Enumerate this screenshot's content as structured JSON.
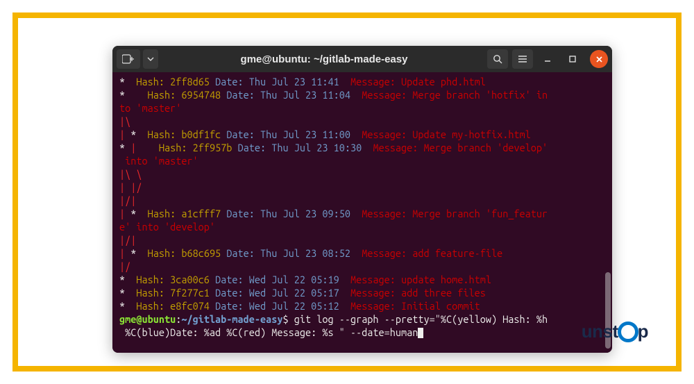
{
  "titlebar": {
    "title": "gme@ubuntu: ~/gitlab-made-easy"
  },
  "log": [
    {
      "graph": "* ",
      "hash": "2ff8d65",
      "date": "Thu Jul 23 11:41",
      "msg": "Update phd.html"
    },
    {
      "graph": "*   ",
      "hash": "6954748",
      "date": "Thu Jul 23 11:04",
      "msg": "Merge branch 'hotfix' in",
      "wrap": "to 'master'"
    },
    {
      "graphonly": "|\\  "
    },
    {
      "graph": "| * ",
      "hash": "b0df1fc",
      "date": "Thu Jul 23 11:00",
      "msg": "Update my-hotfix.html"
    },
    {
      "graph": "* |   ",
      "hash": "2ff957b",
      "date": "Thu Jul 23 10:30",
      "msg": "Merge branch 'develop'",
      "wrap": " into 'master'"
    },
    {
      "graphonly": "|\\ \\  "
    },
    {
      "graphonly": "| |/  "
    },
    {
      "graphonly": "|/|   "
    },
    {
      "graph": "| * ",
      "hash": "a1cfff7",
      "date": "Thu Jul 23 09:50",
      "msg": "Merge branch 'fun_featur",
      "wrap": "e' into 'develop'"
    },
    {
      "graphonly": "|/|   "
    },
    {
      "graph": "| * ",
      "hash": "b68c695",
      "date": "Thu Jul 23 08:52",
      "msg": "add feature-file"
    },
    {
      "graphonly": "|/  "
    },
    {
      "graph": "* ",
      "hash": "3ca00c6",
      "date": "Wed Jul 22 05:19",
      "msg": "update home.html"
    },
    {
      "graph": "* ",
      "hash": "7f277c1",
      "date": "Wed Jul 22 05:17",
      "msg": "add three files"
    },
    {
      "graph": "* ",
      "hash": "e8fc074",
      "date": "Wed Jul 22 05:12",
      "msg": "Initial commit"
    }
  ],
  "labels": {
    "hash": "Hash: ",
    "date": "Date: ",
    "message": " Message: "
  },
  "prompt": {
    "userhost": "gme@ubuntu",
    "sep": ":",
    "path": "~/gitlab-made-easy",
    "dollar": "$ ",
    "cmd1": "git log --graph --pretty=\"%C(yellow) Hash: %h",
    "cmd2": " %C(blue)Date: %ad %C(red) Message: %s \" --date=human"
  },
  "brand": {
    "un": "un",
    "stop": "st",
    "p": "p"
  }
}
